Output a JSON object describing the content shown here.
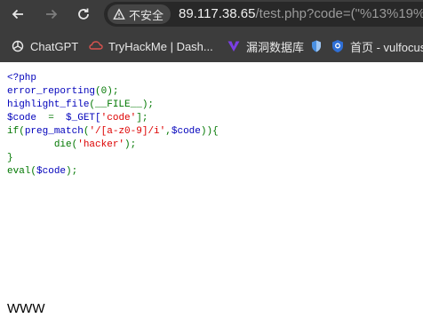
{
  "browser": {
    "security_label": "不安全",
    "url_host": "89.117.38.65",
    "url_rest": "/test.php?code=(\"%13%19%",
    "bookmarks": [
      {
        "label": "ChatGPT",
        "icon": "chatgpt-icon"
      },
      {
        "label": "TryHackMe | Dash...",
        "icon": "tryhackme-icon"
      },
      {
        "label": "漏洞数据库",
        "icon": "vulnerability-db-icon"
      },
      {
        "label": "首页 - vulfocus",
        "icon": "vulfocus-icon"
      }
    ]
  },
  "source": {
    "open_tag": "<?php",
    "line2_fn": "error_reporting",
    "line2_args": "(0);",
    "line3_fn": "highlight_file",
    "line3_args": "(__FILE__);",
    "line4_var": "$code ",
    "line4_op": " = ",
    "line4_get": " $_GET[",
    "line4_key": "'code'",
    "line4_end": "];",
    "line5_if": "if(",
    "line5_fn": "preg_match",
    "line5_open": "(",
    "line5_pattern": "'/[a-z0-9]/i'",
    "line5_comma": ",",
    "line5_var": "$code",
    "line5_close": ")){",
    "line6_indent": "        ",
    "line6_die": "die(",
    "line6_msg": "'hacker'",
    "line6_end": ");",
    "line7": "}",
    "line8_eval": "eval(",
    "line8_var": "$code",
    "line8_end": ");"
  },
  "output": "WWW",
  "colors": {
    "php_default": "#0000bb",
    "php_keyword": "#007700",
    "php_string": "#dd0000",
    "chrome_bg": "#3c3c3c"
  }
}
